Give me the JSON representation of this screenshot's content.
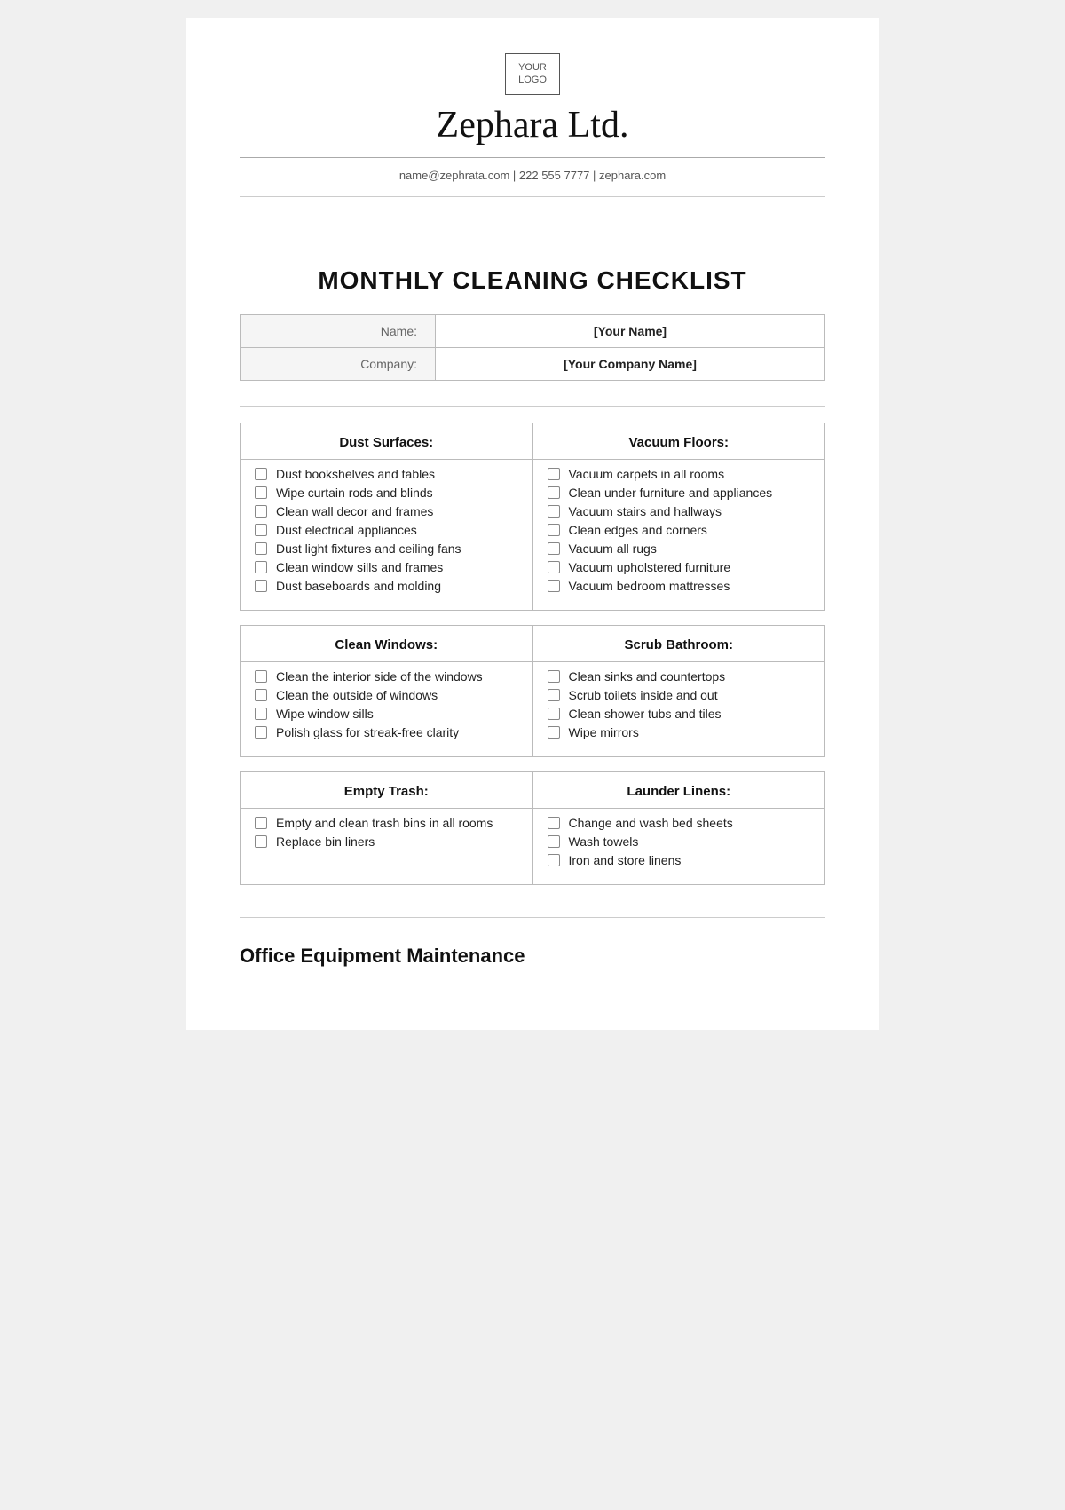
{
  "header": {
    "logo_line1": "YOUR",
    "logo_line2": "LOGO",
    "company_name": "Zephara Ltd.",
    "contact": "name@zephrata.com | 222 555 7777 | zephara.com"
  },
  "title": "MONTHLY CLEANING CHECKLIST",
  "info_fields": [
    {
      "label": "Name:",
      "value": "[Your Name]"
    },
    {
      "label": "Company:",
      "value": "[Your Company Name]"
    }
  ],
  "sections": [
    {
      "left_title": "Dust Surfaces:",
      "left_items": [
        "Dust bookshelves and tables",
        "Wipe curtain rods and blinds",
        "Clean wall decor and frames",
        "Dust electrical appliances",
        "Dust light fixtures and ceiling fans",
        "Clean window sills and frames",
        "Dust baseboards and molding"
      ],
      "right_title": "Vacuum Floors:",
      "right_items": [
        "Vacuum carpets in all rooms",
        "Clean under furniture and appliances",
        "Vacuum stairs and hallways",
        "Clean edges and corners",
        "Vacuum all rugs",
        "Vacuum upholstered furniture",
        "Vacuum bedroom mattresses"
      ]
    },
    {
      "left_title": "Clean Windows:",
      "left_items": [
        "Clean the interior side of the windows",
        "Clean the outside of windows",
        "Wipe window sills",
        "Polish glass for streak-free clarity"
      ],
      "right_title": "Scrub Bathroom:",
      "right_items": [
        "Clean sinks and countertops",
        "Scrub toilets inside and out",
        "Clean shower tubs and tiles",
        "Wipe mirrors"
      ]
    },
    {
      "left_title": "Empty Trash:",
      "left_items": [
        "Empty and clean trash bins in all rooms",
        "Replace bin liners"
      ],
      "right_title": "Launder Linens:",
      "right_items": [
        "Change and wash bed sheets",
        "Wash towels",
        "Iron and store linens"
      ]
    }
  ],
  "office_section_title": "Office Equipment Maintenance"
}
